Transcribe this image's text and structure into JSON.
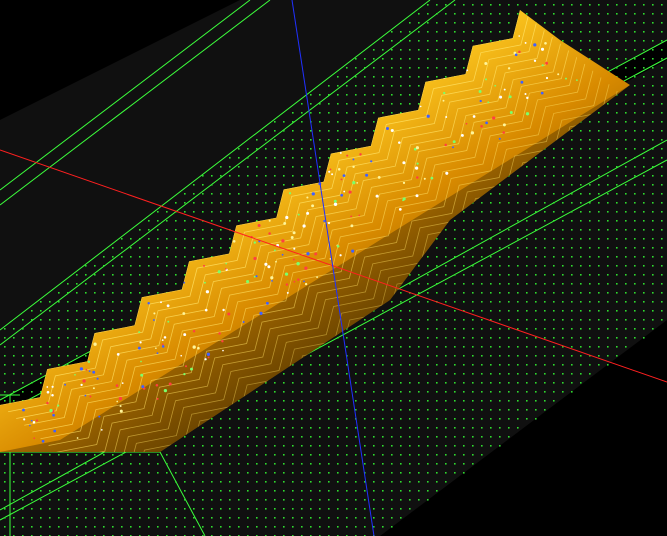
{
  "viewport": {
    "background_color": "#000000",
    "slab_color": "#101010",
    "scene": "3d-cad-toolpath-simulation",
    "axes": {
      "x_axis_color": "#ff2020",
      "y_axis_color": "#2030ff"
    },
    "stock_boundary_color": "#3cff3c",
    "toolpath_point_color": "#2fdc2f",
    "part_colors": {
      "base": "#5a3a00",
      "mid": "#d88a00",
      "surface": "#ffcc22",
      "highlight": "#fff6c0",
      "contour": "#ffe060"
    },
    "marker_colors": [
      "#ffffff",
      "#7cff6a",
      "#ff4040",
      "#4060ff",
      "#fff59a"
    ]
  }
}
